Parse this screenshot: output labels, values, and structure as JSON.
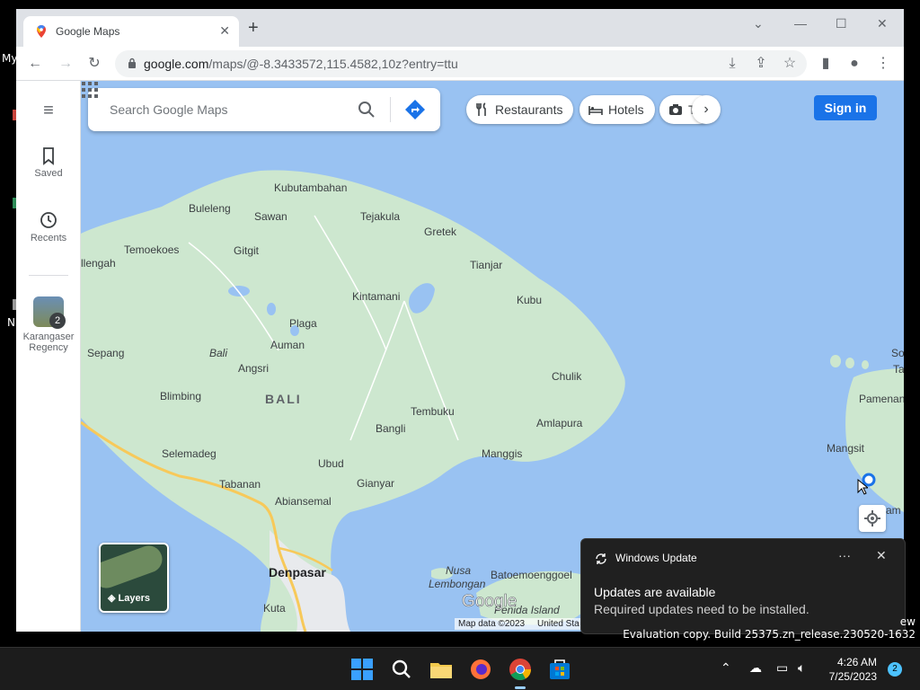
{
  "desktop": {
    "frag_my": "My",
    "frag_n": "N"
  },
  "browser": {
    "tab_title": "Google Maps",
    "new_tab": "+",
    "url_host": "google.com",
    "url_path": "/maps/@-8.3433572,115.4582,10z?entry=ttu"
  },
  "maps": {
    "search_placeholder": "Search Google Maps",
    "chips": [
      "Restaurants",
      "Hotels",
      "T"
    ],
    "sign_in": "Sign in",
    "rail": {
      "saved": "Saved",
      "recents": "Recents",
      "place_line1": "Karangaser",
      "place_line2": "Regency",
      "place_count": "2"
    },
    "layers": "Layers",
    "map_data": "Map data ©2023",
    "map_data_extra": "United Sta",
    "labels": {
      "kubutambahan": "Kubutambahan",
      "buleleng": "Buleleng",
      "sawan": "Sawan",
      "tejakula": "Tejakula",
      "gretek": "Gretek",
      "temoekoes": "Temoekoes",
      "gitgit": "Gitgit",
      "llengah": "llengah",
      "tianjar": "Tianjar",
      "kintamani": "Kintamani",
      "kubu": "Kubu",
      "plaga": "Plaga",
      "auman": "Auman",
      "sepang": "Sepang",
      "bali_it": "Bali",
      "angsri": "Angsri",
      "chulik": "Chulik",
      "blimbing": "Blimbing",
      "bali": "BALI",
      "tembuku": "Tembuku",
      "amlapura": "Amlapura",
      "bangli": "Bangli",
      "selemadeg": "Selemadeg",
      "manggis": "Manggis",
      "ubud": "Ubud",
      "tabanan": "Tabanan",
      "gianyar": "Gianyar",
      "abiansemal": "Abiansemal",
      "denpasar": "Denpasar",
      "nusa": "Nusa",
      "lembongan": "Lembongan",
      "batoe": "Batoemoenggoel",
      "penida": "Penida Island",
      "kuta": "Kuta",
      "pamenang": "Pamenan",
      "mangsit": "Mangsit",
      "tam": "Tam",
      "so": "So",
      "m_am": "am"
    }
  },
  "notification": {
    "app": "Windows Update",
    "title": "Updates are available",
    "body": "Required updates need to be installed.",
    "more": "···",
    "close": "✕"
  },
  "watermark": {
    "line1": "ew",
    "line2": "Evaluation copy. Build 25375.zn_release.230520-1632"
  },
  "taskbar": {
    "time": "4:26 AM",
    "date": "7/25/2023",
    "badge": "2"
  },
  "colors": {
    "water": "#99c2f2",
    "land": "#cde7cf",
    "signin": "#1a73e8",
    "accent": "#4cc2ff"
  }
}
